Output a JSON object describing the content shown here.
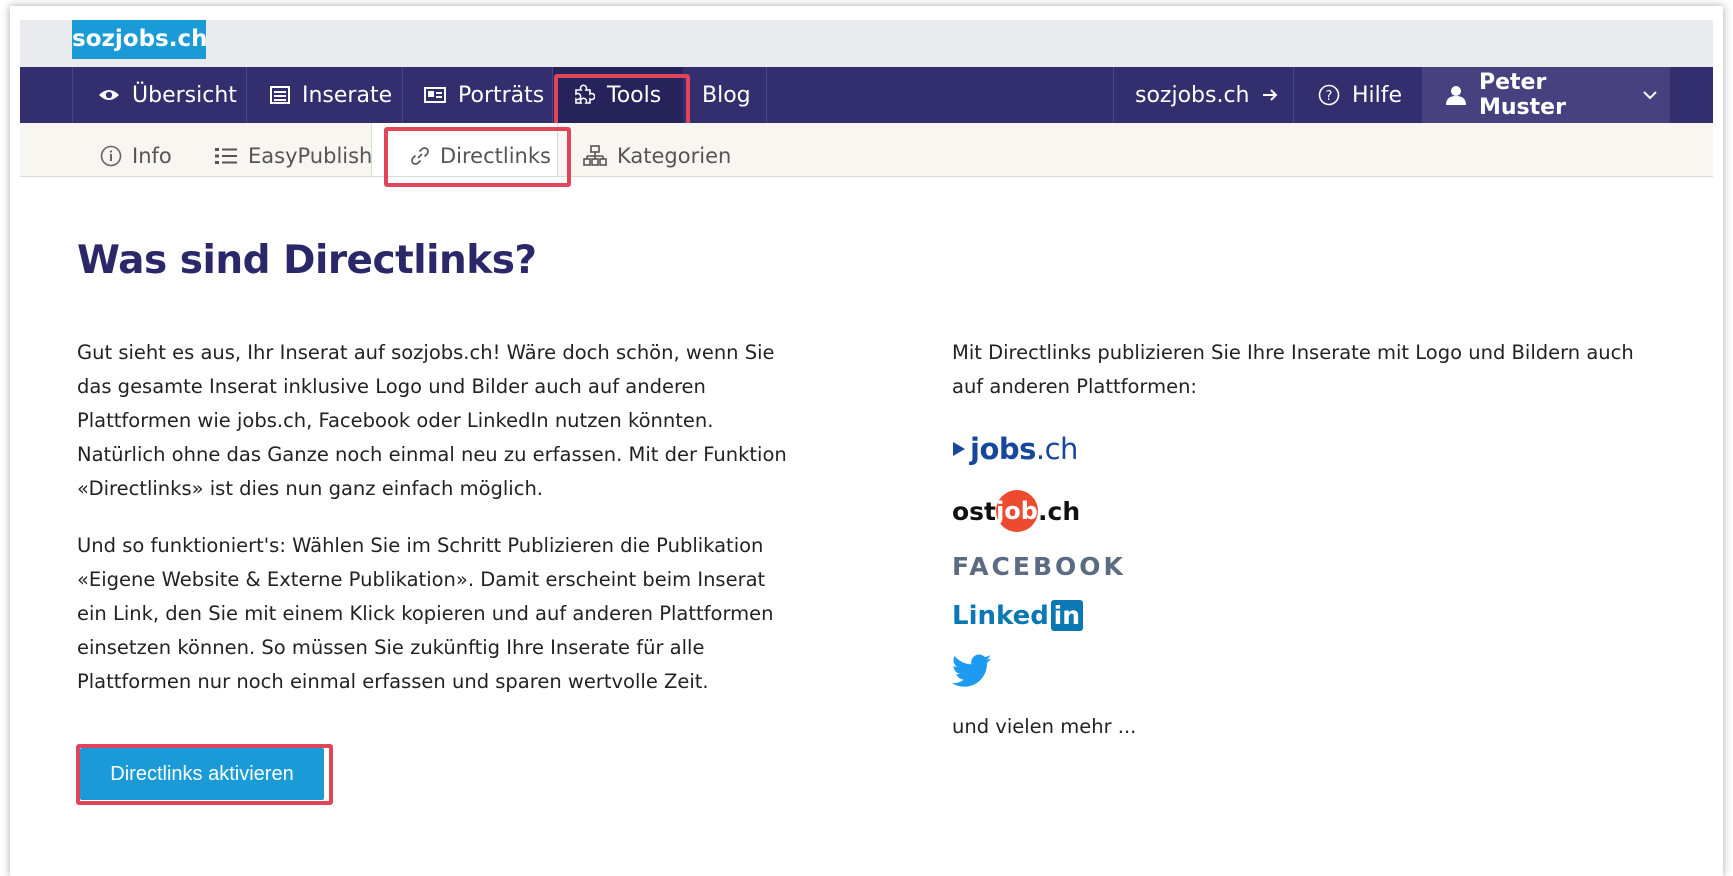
{
  "brand": {
    "name": "sozjobs.ch"
  },
  "main_nav": {
    "items": [
      {
        "label": "Übersicht",
        "icon": "eye-icon"
      },
      {
        "label": "Inserate",
        "icon": "list-box-icon"
      },
      {
        "label": "Porträts",
        "icon": "id-card-icon"
      },
      {
        "label": "Tools",
        "icon": "puzzle-icon",
        "active": true
      },
      {
        "label": "Blog"
      }
    ],
    "right": {
      "site_link": {
        "label": "sozjobs.ch",
        "icon": "arrow-right-icon"
      },
      "help": {
        "label": "Hilfe",
        "icon": "question-circle-icon"
      },
      "user": {
        "label": "Peter Muster",
        "icon": "user-icon",
        "chevron": "chevron-down-icon"
      }
    }
  },
  "sub_nav": {
    "items": [
      {
        "label": "Info",
        "icon": "info-circle-icon"
      },
      {
        "label": "EasyPublish",
        "icon": "list-icon"
      },
      {
        "label": "Directlinks",
        "icon": "link-icon",
        "active": true
      },
      {
        "label": "Kategorien",
        "icon": "sitemap-icon"
      }
    ]
  },
  "content": {
    "title": "Was sind Directlinks?",
    "left": {
      "paragraph1": [
        "Gut sieht es aus, Ihr Inserat auf sozjobs.ch! Wäre doch schön, wenn Sie",
        "das gesamte Inserat inklusive Logo und Bilder auch auf anderen",
        "Plattformen wie jobs.ch, Facebook oder LinkedIn nutzen könnten.",
        "Natürlich ohne das Ganze noch einmal neu zu erfassen. Mit der Funktion",
        "«Directlinks» ist dies nun ganz einfach möglich."
      ],
      "paragraph2": [
        "Und so funktioniert's: Wählen Sie im Schritt Publizieren die Publikation",
        "«Eigene Website & Externe Publikation». Damit erscheint beim Inserat",
        "ein Link, den Sie mit einem Klick kopieren und auf anderen Plattformen",
        "einsetzen können. So müssen Sie zukünftig Ihre Inserate für alle",
        "Plattformen nur noch einmal erfassen und sparen wertvolle Zeit."
      ],
      "button_label": "Directlinks aktivieren"
    },
    "right": {
      "intro": [
        "Mit Directlinks publizieren Sie Ihre Inserate mit Logo und Bildern auch",
        "auf anderen Plattformen:"
      ],
      "logos": {
        "jobs": {
          "text": "jobs",
          "suffix": ".ch"
        },
        "ostjob": {
          "pre": "ost",
          "mid": "job",
          "post": ".ch"
        },
        "facebook": "FACEBOOK",
        "linkedin": {
          "text": "Linked",
          "in": "in"
        },
        "twitter": "twitter-bird-icon"
      },
      "outro": "und vielen mehr ..."
    }
  },
  "colors": {
    "nav_bg": "#332e6e",
    "brand_blue": "#1a9bd7",
    "highlight": "#e0455a",
    "title": "#2b2869",
    "jobs_blue": "#16479c",
    "ostjob_red": "#ec4b2f",
    "facebook_gray": "#5b6b82",
    "linkedin_blue": "#0b77b5",
    "twitter_blue": "#1d9bf0"
  }
}
